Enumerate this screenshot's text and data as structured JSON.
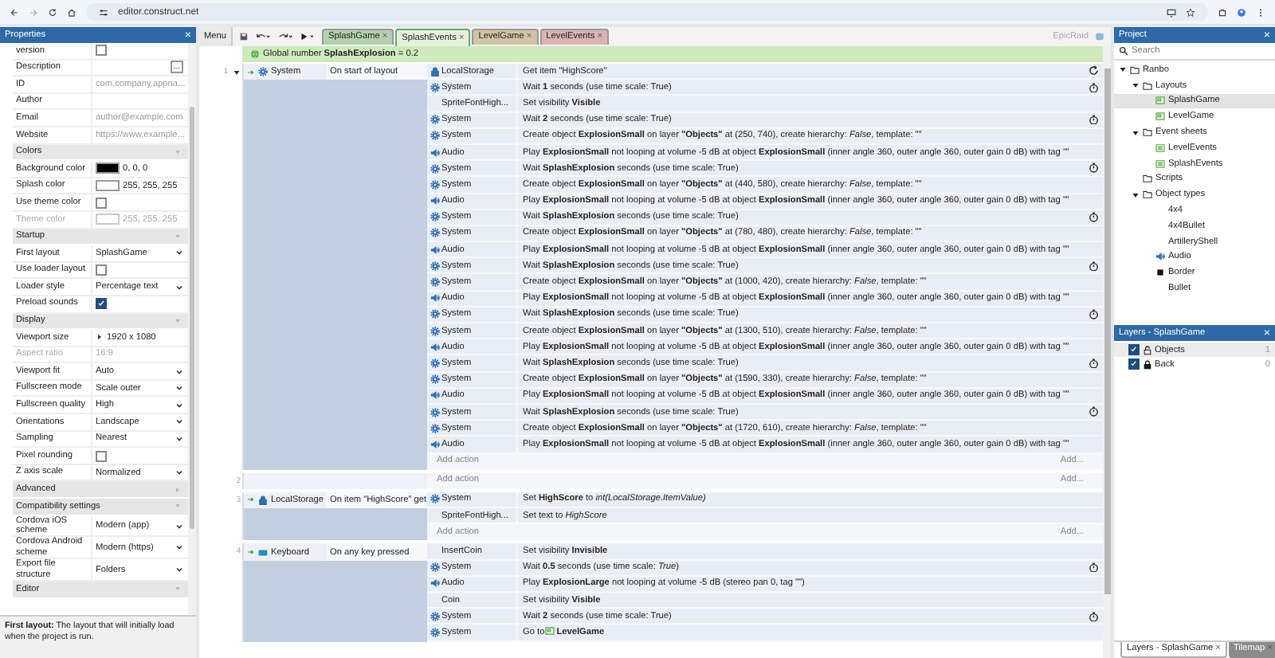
{
  "browser": {
    "url": "editor.construct.net"
  },
  "properties": {
    "title": "Properties",
    "close": "×",
    "rows": [
      {
        "kind": "checkbox",
        "label": "version",
        "checked": false,
        "disabled": false
      },
      {
        "kind": "button",
        "label": "Description",
        "button": "...",
        "disabled": false
      },
      {
        "kind": "text",
        "label": "ID",
        "placeholder": "com.company.appna...",
        "disabled": false
      },
      {
        "kind": "text",
        "label": "Author",
        "disabled": false
      },
      {
        "kind": "text",
        "label": "Email",
        "placeholder": "author@example.com",
        "disabled": false
      },
      {
        "kind": "text",
        "label": "Website",
        "placeholder": "https://www.example...",
        "disabled": false
      },
      {
        "kind": "section",
        "label": "Colors",
        "expanded": true
      },
      {
        "kind": "color",
        "label": "Background color",
        "color": "#000000",
        "value": "0, 0, 0",
        "disabled": false
      },
      {
        "kind": "color",
        "label": "Splash color",
        "color": "#ffffff",
        "value": "255, 255, 255",
        "disabled": false
      },
      {
        "kind": "checkbox",
        "label": "Use theme color",
        "checked": false,
        "disabled": false
      },
      {
        "kind": "color",
        "label": "Theme color",
        "color": "#ffffff",
        "value": "255, 255, 255",
        "disabled": true
      },
      {
        "kind": "section",
        "label": "Startup",
        "expanded": true
      },
      {
        "kind": "dropdown",
        "label": "First layout",
        "value": "SplashGame",
        "disabled": false
      },
      {
        "kind": "checkbox",
        "label": "Use loader layout",
        "checked": false,
        "disabled": false
      },
      {
        "kind": "dropdown",
        "label": "Loader style",
        "value": "Percentage text",
        "disabled": false
      },
      {
        "kind": "checkbox",
        "label": "Preload sounds",
        "checked": true,
        "disabled": false
      },
      {
        "kind": "section",
        "label": "Display",
        "expanded": true
      },
      {
        "kind": "expander",
        "label": "Viewport size",
        "value": "1920 x 1080",
        "disabled": false
      },
      {
        "kind": "text",
        "label": "Aspect ratio",
        "value": "16:9",
        "disabled": true
      },
      {
        "kind": "dropdown",
        "label": "Viewport fit",
        "value": "Auto",
        "disabled": false
      },
      {
        "kind": "dropdown",
        "label": "Fullscreen mode",
        "value": "Scale outer",
        "disabled": false
      },
      {
        "kind": "dropdown",
        "label": "Fullscreen quality",
        "value": "High",
        "disabled": false
      },
      {
        "kind": "dropdown",
        "label": "Orientations",
        "value": "Landscape",
        "disabled": false
      },
      {
        "kind": "dropdown",
        "label": "Sampling",
        "value": "Nearest",
        "disabled": false
      },
      {
        "kind": "checkbox",
        "label": "Pixel rounding",
        "checked": false,
        "disabled": false
      },
      {
        "kind": "dropdown",
        "label": "Z axis scale",
        "value": "Normalized",
        "disabled": false
      },
      {
        "kind": "section",
        "label": "Advanced",
        "expanded": false
      },
      {
        "kind": "section",
        "label": "Compatibility settings",
        "expanded": true
      },
      {
        "kind": "dropdown",
        "label": "Cordova iOS scheme",
        "value": "Modern (app)",
        "disabled": false
      },
      {
        "kind": "dropdown",
        "label": "Cordova Android scheme",
        "value": "Modern (https)",
        "disabled": false
      },
      {
        "kind": "dropdown",
        "label": "Export file structure",
        "value": "Folders",
        "disabled": false
      },
      {
        "kind": "section",
        "label": "Editor",
        "expanded": true
      }
    ],
    "help": "**First layout:** The layout that will initially load when the project is run."
  },
  "toolbar": {
    "menu": "Menu",
    "tabs": [
      {
        "label": "SplashGame",
        "color": "#b5d0ae",
        "selected": false,
        "close": "×"
      },
      {
        "label": "SplashEvents",
        "color": "#e4f0dc",
        "selected": true,
        "close": "×"
      },
      {
        "label": "LevelGame",
        "color": "#d1c4a6",
        "selected": false,
        "close": "×"
      },
      {
        "label": "LevelEvents",
        "color": "#dcb3b3",
        "selected": false,
        "close": "×"
      }
    ],
    "project_label": "EpicRaid"
  },
  "global_variable": "Global number **SplashExplosion** = 0.2",
  "events": [
    {
      "number": "1",
      "collapse_arrow": true,
      "conditions": [
        {
          "kind": "system",
          "object": "System",
          "text": "On start of layout"
        }
      ],
      "actions": [
        {
          "kind": "storage",
          "object": "LocalStorage",
          "text": "Get item \"HighScore\"",
          "awaits": true
        },
        {
          "kind": "system",
          "object": "System",
          "text": "Wait **1** seconds (use time scale: True)",
          "awaits": true
        },
        {
          "kind": "plain",
          "object": "SpriteFontHigh...",
          "text": "Set visibility **Visible**",
          "awaits": false
        },
        {
          "kind": "system",
          "object": "System",
          "text": "Wait **2** seconds (use time scale: True)",
          "awaits": true
        },
        {
          "kind": "system",
          "object": "System",
          "text": "Create object **ExplosionSmall** on layer **\"Objects\"** at (250, 740), create hierarchy: *False*, template: \"\"",
          "awaits": false
        },
        {
          "kind": "audio",
          "object": "Audio",
          "text": "Play **ExplosionSmall** not looping at volume -5 dB at object **ExplosionSmall** (inner angle 360, outer angle 360, outer gain 0 dB) with tag \"\"",
          "awaits": false
        },
        {
          "kind": "system",
          "object": "System",
          "text": "Wait **SplashExplosion** seconds (use time scale: True)",
          "awaits": true
        },
        {
          "kind": "system",
          "object": "System",
          "text": "Create object **ExplosionSmall** on layer **\"Objects\"** at (440, 580), create hierarchy: *False*, template: \"\"",
          "awaits": false
        },
        {
          "kind": "audio",
          "object": "Audio",
          "text": "Play **ExplosionSmall** not looping at volume -5 dB at object **ExplosionSmall** (inner angle 360, outer angle 360, outer gain 0 dB) with tag \"\"",
          "awaits": false
        },
        {
          "kind": "system",
          "object": "System",
          "text": "Wait **SplashExplosion** seconds (use time scale: True)",
          "awaits": true
        },
        {
          "kind": "system",
          "object": "System",
          "text": "Create object **ExplosionSmall** on layer **\"Objects\"** at (780, 480), create hierarchy: *False*, template: \"\"",
          "awaits": false
        },
        {
          "kind": "audio",
          "object": "Audio",
          "text": "Play **ExplosionSmall** not looping at volume -5 dB at object **ExplosionSmall** (inner angle 360, outer angle 360, outer gain 0 dB) with tag \"\"",
          "awaits": false
        },
        {
          "kind": "system",
          "object": "System",
          "text": "Wait **SplashExplosion** seconds (use time scale: True)",
          "awaits": true
        },
        {
          "kind": "system",
          "object": "System",
          "text": "Create object **ExplosionSmall** on layer **\"Objects\"** at (1000, 420), create hierarchy: *False*, template: \"\"",
          "awaits": false
        },
        {
          "kind": "audio",
          "object": "Audio",
          "text": "Play **ExplosionSmall** not looping at volume -5 dB at object **ExplosionSmall** (inner angle 360, outer angle 360, outer gain 0 dB) with tag \"\"",
          "awaits": false
        },
        {
          "kind": "system",
          "object": "System",
          "text": "Wait **SplashExplosion** seconds (use time scale: True)",
          "awaits": true
        },
        {
          "kind": "system",
          "object": "System",
          "text": "Create object **ExplosionSmall** on layer **\"Objects\"** at (1300, 510), create hierarchy: *False*, template: \"\"",
          "awaits": false
        },
        {
          "kind": "audio",
          "object": "Audio",
          "text": "Play **ExplosionSmall** not looping at volume -5 dB at object **ExplosionSmall** (inner angle 360, outer angle 360, outer gain 0 dB) with tag \"\"",
          "awaits": false
        },
        {
          "kind": "system",
          "object": "System",
          "text": "Wait **SplashExplosion** seconds (use time scale: True)",
          "awaits": true
        },
        {
          "kind": "system",
          "object": "System",
          "text": "Create object **ExplosionSmall** on layer **\"Objects\"** at (1590, 330), create hierarchy: *False*, template: \"\"",
          "awaits": false
        },
        {
          "kind": "audio",
          "object": "Audio",
          "text": "Play **ExplosionSmall** not looping at volume -5 dB at object **ExplosionSmall** (inner angle 360, outer angle 360, outer gain 0 dB) with tag \"\"",
          "awaits": false
        },
        {
          "kind": "system",
          "object": "System",
          "text": "Wait **SplashExplosion** seconds (use time scale: True)",
          "awaits": true
        },
        {
          "kind": "system",
          "object": "System",
          "text": "Create object **ExplosionSmall** on layer **\"Objects\"** at (1720, 610), create hierarchy: *False*, template: \"\"",
          "awaits": false
        },
        {
          "kind": "audio",
          "object": "Audio",
          "text": "Play **ExplosionSmall** not looping at volume -5 dB at object **ExplosionSmall** (inner angle 360, outer angle 360, outer gain 0 dB) with tag \"\"",
          "awaits": false
        }
      ],
      "add_action": "Add action",
      "add_more": "Add..."
    },
    {
      "number": "2",
      "collapse_arrow": false,
      "add_action": "Add action",
      "add_more": "Add..."
    },
    {
      "number": "3",
      "collapse_arrow": false,
      "conditions": [
        {
          "kind": "storage",
          "object": "LocalStorage",
          "text": "On item \"HighScore\" get"
        }
      ],
      "actions": [
        {
          "kind": "system",
          "object": "System",
          "text": "Set **HighScore** to *int(LocalStorage.ItemValue)*",
          "awaits": false
        },
        {
          "kind": "plain",
          "object": "SpriteFontHigh...",
          "text": "Set text to *HighScore*",
          "awaits": false
        }
      ],
      "add_action": "Add action",
      "add_more": "Add..."
    },
    {
      "number": "4",
      "collapse_arrow": false,
      "conditions": [
        {
          "kind": "keyboard",
          "object": "Keyboard",
          "text": "On any key pressed"
        }
      ],
      "actions": [
        {
          "kind": "plain",
          "object": "InsertCoin",
          "text": "Set visibility **Invisible**",
          "awaits": false
        },
        {
          "kind": "system",
          "object": "System",
          "text": "Wait **0.5** seconds (use time scale: *True*)",
          "awaits": true
        },
        {
          "kind": "audio",
          "object": "Audio",
          "text": "Play **ExplosionLarge** not looping at volume -5 dB (stereo pan 0, tag \"\")",
          "awaits": false
        },
        {
          "kind": "plain",
          "object": "Coin",
          "text": "Set visibility **Visible**",
          "awaits": false
        },
        {
          "kind": "system",
          "object": "System",
          "text": "Wait **2** seconds (use time scale: True)",
          "awaits": true
        },
        {
          "kind": "system",
          "object": "System",
          "text": "Go to",
          "link": "LevelGame",
          "awaits": false
        }
      ]
    }
  ],
  "project": {
    "title": "Project",
    "close": "×",
    "search_placeholder": "Search",
    "tree": [
      {
        "label": "Ranbo",
        "kind": "folder",
        "expanded": true,
        "selected": false,
        "children": [
          {
            "label": "Layouts",
            "kind": "folder",
            "expanded": true,
            "selected": false,
            "children": [
              {
                "label": "SplashGame",
                "kind": "layout",
                "selected": true
              },
              {
                "label": "LevelGame",
                "kind": "layout",
                "selected": false
              }
            ]
          },
          {
            "label": "Event sheets",
            "kind": "folder",
            "expanded": true,
            "selected": false,
            "children": [
              {
                "label": "LevelEvents",
                "kind": "eventsheet",
                "selected": false
              },
              {
                "label": "SplashEvents",
                "kind": "eventsheet",
                "selected": false
              }
            ]
          },
          {
            "label": "Scripts",
            "kind": "folder",
            "selected": false
          },
          {
            "label": "Object types",
            "kind": "folder",
            "expanded": true,
            "selected": false,
            "children": [
              {
                "label": "4x4",
                "kind": "plain",
                "selected": false
              },
              {
                "label": "4x4Bullet",
                "kind": "plain",
                "selected": false
              },
              {
                "label": "ArtilleryShell",
                "kind": "plain",
                "selected": false
              },
              {
                "label": "Audio",
                "kind": "audio",
                "selected": false
              },
              {
                "label": "Border",
                "kind": "sprite",
                "selected": false
              },
              {
                "label": "Bullet",
                "kind": "plain",
                "selected": false
              }
            ]
          }
        ]
      }
    ]
  },
  "layers": {
    "title": "Layers - SplashGame",
    "close": "×",
    "rows": [
      {
        "label": "Objects",
        "count": "1",
        "visible": true,
        "locked": false,
        "selected": true
      },
      {
        "label": "Back",
        "count": "0",
        "visible": true,
        "locked": true,
        "selected": false
      }
    ]
  },
  "bottom_tabs": [
    {
      "label": "Layers - SplashGame",
      "close": "×",
      "selected": true
    },
    {
      "label": "Tilemap",
      "close": "×",
      "selected": false
    }
  ]
}
